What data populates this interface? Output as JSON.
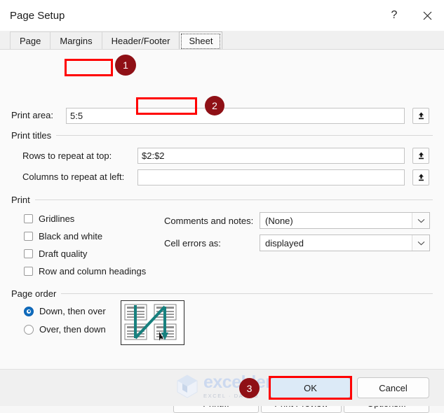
{
  "window": {
    "title": "Page Setup",
    "help_icon": "question-mark-icon",
    "close_icon": "close-icon"
  },
  "tabs": [
    {
      "label": "Page",
      "active": false
    },
    {
      "label": "Margins",
      "active": false
    },
    {
      "label": "Header/Footer",
      "active": false
    },
    {
      "label": "Sheet",
      "active": true
    }
  ],
  "sheet": {
    "print_area": {
      "label": "Print area:",
      "value": "5:5",
      "collapse_icon": "collapse-dialog-icon"
    },
    "print_titles": {
      "group_label": "Print titles",
      "rows_label": "Rows to repeat at top:",
      "rows_value": "$2:$2",
      "cols_label": "Columns to repeat at left:",
      "cols_value": "",
      "collapse_icon": "collapse-dialog-icon"
    },
    "print": {
      "group_label": "Print",
      "checkboxes": [
        {
          "label": "Gridlines",
          "checked": false
        },
        {
          "label": "Black and white",
          "checked": false
        },
        {
          "label": "Draft quality",
          "checked": false
        },
        {
          "label": "Row and column headings",
          "checked": false
        }
      ],
      "comments_label": "Comments and notes:",
      "comments_value": "(None)",
      "cell_errors_label": "Cell errors as:",
      "cell_errors_value": "displayed",
      "dropdown_icon": "chevron-down-icon"
    },
    "page_order": {
      "group_label": "Page order",
      "options": [
        {
          "label": "Down, then over",
          "selected": true
        },
        {
          "label": "Over, then down",
          "selected": false
        }
      ],
      "preview_icon": "page-order-preview-icon"
    }
  },
  "buttons": {
    "print": "Print...",
    "print_preview": "Print Preview",
    "options": "Options...",
    "ok": "OK",
    "cancel": "Cancel"
  },
  "annotations": {
    "badges": [
      {
        "number": "1"
      },
      {
        "number": "2"
      },
      {
        "number": "3"
      }
    ],
    "box_color": "#ff0000",
    "badge_color": "#8f1016"
  },
  "watermark": {
    "name": "exceldemy",
    "tagline": "EXCEL  ·  DATA  B"
  }
}
